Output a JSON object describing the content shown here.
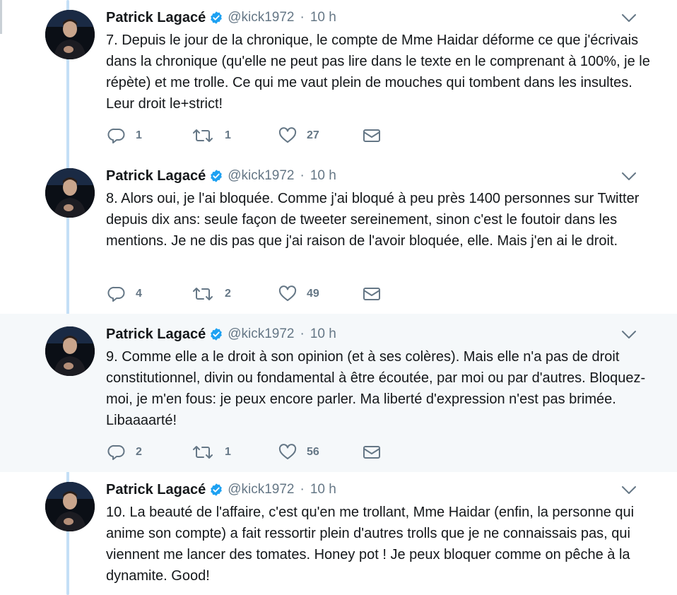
{
  "tweets": [
    {
      "author": "Patrick Lagacé",
      "handle": "@kick1972",
      "separator": "·",
      "time": "10 h",
      "text": "7. Depuis le jour de la chronique, le compte de Mme Haidar déforme ce que j'écrivais dans la chronique (qu'elle ne peut pas lire dans le texte en le comprenant à 100%, je le répète) et me trolle. Ce qui me vaut plein de mouches qui tombent dans les insultes. Leur droit le+strict!",
      "replies": "1",
      "retweets": "1",
      "likes": "27"
    },
    {
      "author": "Patrick Lagacé",
      "handle": "@kick1972",
      "separator": "·",
      "time": "10 h",
      "text": "8. Alors oui, je l'ai bloquée. Comme j'ai bloqué à peu près 1400 personnes sur Twitter depuis dix ans: seule façon de tweeter sereinement, sinon c'est le foutoir dans les mentions. Je ne dis pas que j'ai raison de l'avoir bloquée, elle. Mais j'en ai le droit.",
      "replies": "4",
      "retweets": "2",
      "likes": "49"
    },
    {
      "author": "Patrick Lagacé",
      "handle": "@kick1972",
      "separator": "·",
      "time": "10 h",
      "text": "9. Comme elle a le droit à son opinion (et à ses colères). Mais elle n'a pas de droit constitutionnel, divin ou fondamental à être écoutée, par moi ou par d'autres. Bloquez-moi, je m'en fous: je peux encore parler. Ma liberté d'expression n'est pas brimée. Libaaaarté!",
      "replies": "2",
      "retweets": "1",
      "likes": "56"
    },
    {
      "author": "Patrick Lagacé",
      "handle": "@kick1972",
      "separator": "·",
      "time": "10 h",
      "text": "10. La beauté de l'affaire, c'est qu'en me trollant, Mme Haidar (enfin, la personne qui anime son compte) a fait ressortir plein d'autres trolls que je ne connaissais pas, qui viennent me lancer des tomates. Honey pot ! Je peux bloquer comme on pêche à la dynamite. Good!"
    }
  ],
  "icons": {
    "verified": "verified-badge-icon",
    "caret": "chevron-down-icon",
    "reply": "reply-icon",
    "retweet": "retweet-icon",
    "like": "heart-icon",
    "dm": "direct-message-icon"
  },
  "colors": {
    "text": "#14171a",
    "muted": "#657786",
    "verified": "#1da1f2",
    "thread_line": "#c4dff6",
    "highlight_bg": "#f5f8fa"
  }
}
